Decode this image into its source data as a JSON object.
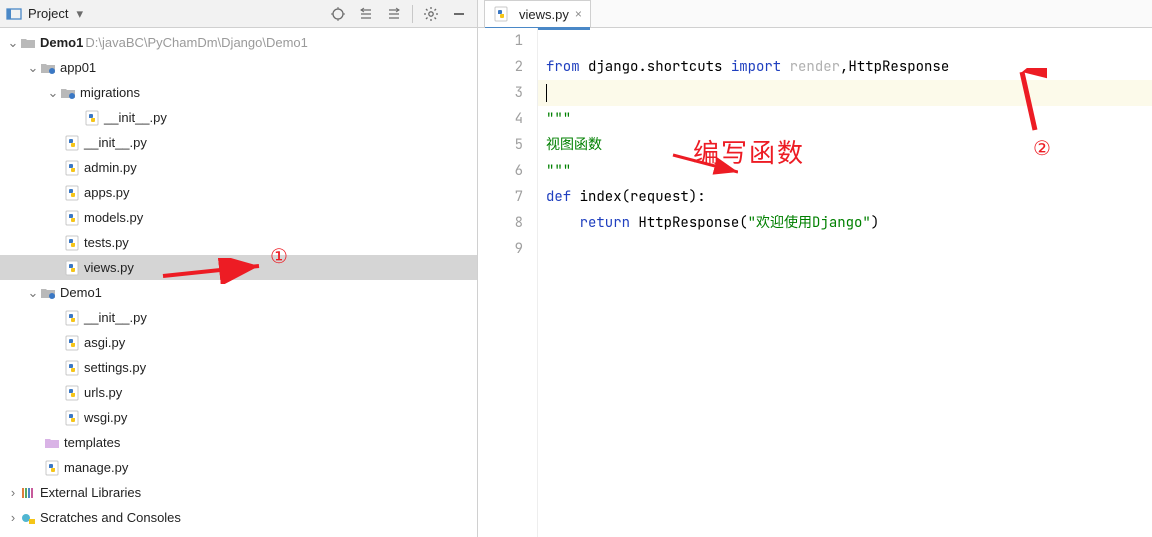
{
  "header": {
    "project_label": "Project"
  },
  "tree": {
    "root": {
      "name": "Demo1",
      "path": "D:\\javaBC\\PyChamDm\\Django\\Demo1"
    },
    "app01": "app01",
    "migrations": "migrations",
    "mig_init": "__init__.py",
    "app_init": "__init__.py",
    "admin": "admin.py",
    "apps": "apps.py",
    "models": "models.py",
    "tests": "tests.py",
    "views": "views.py",
    "demo1_pkg": "Demo1",
    "pkg_init": "__init__.py",
    "asgi": "asgi.py",
    "settings": "settings.py",
    "urls": "urls.py",
    "wsgi": "wsgi.py",
    "templates": "templates",
    "manage": "manage.py",
    "ext_libs": "External Libraries",
    "scratches": "Scratches and Consoles"
  },
  "tab": {
    "label": "views.py"
  },
  "code": {
    "l1": "",
    "l2_from": "from",
    "l2_mod": " django.shortcuts ",
    "l2_import": "import",
    "l2_render": " render",
    "l2_rest": ",HttpResponse",
    "l3": "",
    "l4": "\"\"\"",
    "l5": "视图函数",
    "l6": "\"\"\"",
    "l7_def": "def",
    "l7_sig": " index(request):",
    "l8_return": "return",
    "l8_rest": " HttpResponse(",
    "l8_str": "\"欢迎使用Django\"",
    "l8_close": ")",
    "l9": ""
  },
  "line_numbers": [
    "1",
    "2",
    "3",
    "4",
    "5",
    "6",
    "7",
    "8",
    "9"
  ],
  "annotations": {
    "one": "①",
    "two": "②",
    "cn": "编写函数"
  }
}
